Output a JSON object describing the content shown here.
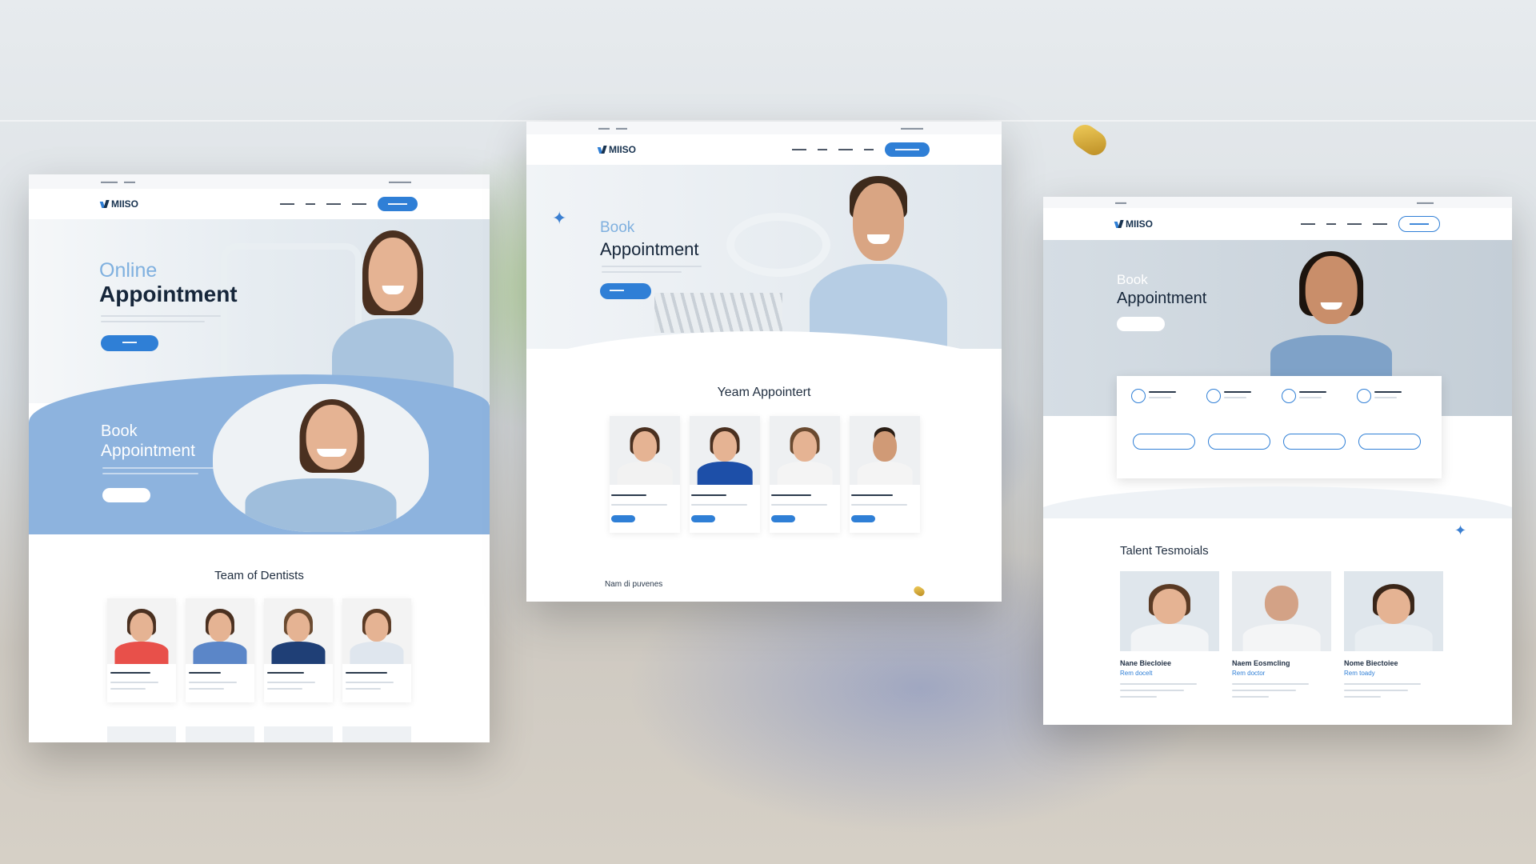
{
  "panel_left": {
    "brand": "MIISO",
    "hero_title_light": "Online",
    "hero_title_bold": "Appointment",
    "book_title_light": "Book",
    "book_title_bold": "Appointment",
    "section_title": "Team of Dentists"
  },
  "panel_center": {
    "brand": "MIISO",
    "hero_title_light": "Book",
    "hero_title_bold": "Appointment",
    "section_title": "Yeam Appointert",
    "footer_text": "Nam di puvenes"
  },
  "panel_right": {
    "brand": "MIISO",
    "hero_title_light": "Book",
    "hero_title_bold": "Appointment",
    "section_title": "Talent Tesmoials",
    "testimonials": [
      {
        "name": "Nane Biecloiee",
        "role": "Rem docelt"
      },
      {
        "name": "Naem Eosmcling",
        "role": "Rem doctor"
      },
      {
        "name": "Nome Biectoiee",
        "role": "Rem toady"
      }
    ]
  },
  "colors": {
    "accent": "#2f7fd6",
    "light_blue": "#7fb0df",
    "wave_blue": "#8db3de",
    "pill_gold": "#d9ac3a"
  },
  "icons": [
    "sparkle-icon",
    "clock-icon",
    "calendar-icon",
    "tooth-icon",
    "check-icon"
  ]
}
